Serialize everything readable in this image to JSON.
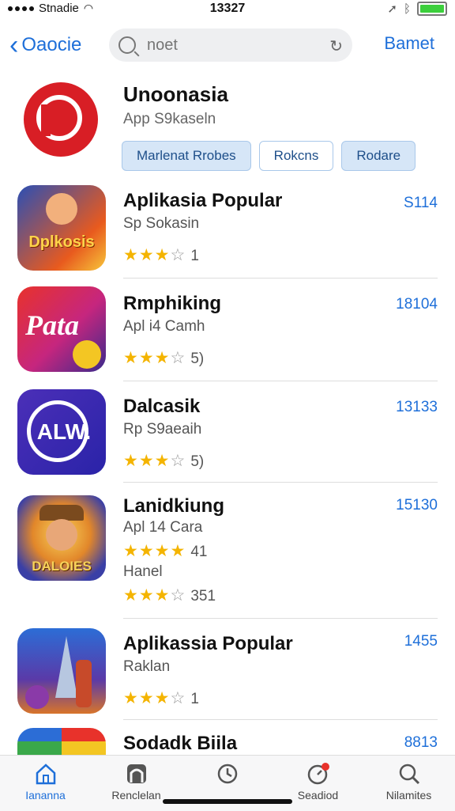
{
  "status": {
    "carrier": "Stnadie",
    "time": "13327"
  },
  "nav": {
    "back_label": "Oaocie",
    "search_placeholder": "noet",
    "right_button": "Bamet"
  },
  "featured": {
    "title": "Unoonasia",
    "subtitle": "App S9kaseln",
    "chips": [
      "Marlenat Rrobes",
      "Rokcns",
      "Rodare"
    ]
  },
  "apps": [
    {
      "name": "Aplikasia Popular",
      "subtitle": "Sp Sokasin",
      "stars": "★★★",
      "stars_empty": "☆",
      "count": "1",
      "price": "S114",
      "icon_text": "Dplkosis"
    },
    {
      "name": "Rmphiking",
      "subtitle": "Apl i4 Camh",
      "stars": "★★★",
      "stars_empty": "☆",
      "count": "5)",
      "price": "18104",
      "icon_text": "Pata"
    },
    {
      "name": "Dalcasik",
      "subtitle": "Rp S9aeaih",
      "stars": "★★★",
      "stars_empty": "☆",
      "count": "5)",
      "price": "13133",
      "icon_text": "ALW."
    },
    {
      "name": "Lanidkiung",
      "subtitle": "Apl 14 Cara",
      "stars": "★★★★",
      "stars_empty": "",
      "count": "41",
      "subtitle2": "Hanel",
      "stars2": "★★★",
      "stars2_empty": "☆",
      "count2": "351",
      "price": "15130",
      "icon_text": "DALOIES"
    },
    {
      "name": "Aplikassia Popular",
      "subtitle": "Raklan",
      "stars": "★★★",
      "stars_empty": "☆",
      "count": "1",
      "price": "1455"
    },
    {
      "name": "Sodadk Biila",
      "price": "8813"
    }
  ],
  "tabs": [
    "Iananna",
    "Renclelan",
    "",
    "Seadiod",
    "Nilamites"
  ],
  "colors": {
    "accent": "#1e6fd9",
    "star": "#f4b400",
    "featured_icon": "#d81e25"
  }
}
